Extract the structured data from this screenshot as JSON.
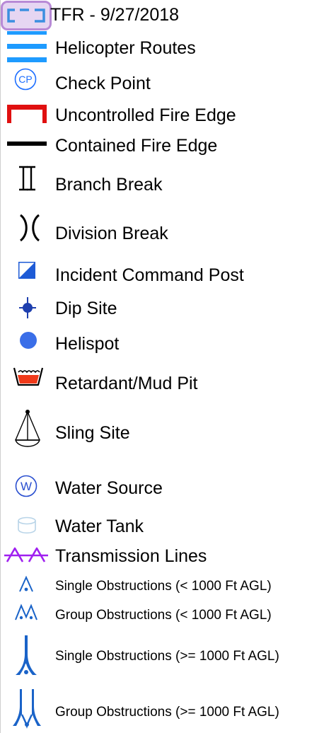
{
  "legend": {
    "items": [
      {
        "key": "tfr",
        "label": "TFR - 9/27/2018",
        "icon": "tfr-boundary-icon"
      },
      {
        "key": "helicopter_routes",
        "label": "Helicopter Routes",
        "icon": "helicopter-route-icon"
      },
      {
        "key": "check_point",
        "label": "Check Point",
        "icon": "check-point-icon",
        "icon_text": "CP"
      },
      {
        "key": "uncontrolled_fire_edge",
        "label": "Uncontrolled Fire Edge",
        "icon": "uncontrolled-fire-edge-icon"
      },
      {
        "key": "contained_fire_edge",
        "label": "Contained Fire Edge",
        "icon": "contained-fire-edge-icon"
      },
      {
        "key": "branch_break",
        "label": "Branch Break",
        "icon": "branch-break-icon"
      },
      {
        "key": "division_break",
        "label": "Division Break",
        "icon": "division-break-icon"
      },
      {
        "key": "incident_command_post",
        "label": "Incident Command Post",
        "icon": "incident-command-post-icon"
      },
      {
        "key": "dip_site",
        "label": "Dip Site",
        "icon": "dip-site-icon"
      },
      {
        "key": "helispot",
        "label": "Helispot",
        "icon": "helispot-icon"
      },
      {
        "key": "retardant_mud_pit",
        "label": "Retardant/Mud Pit",
        "icon": "retardant-mud-pit-icon"
      },
      {
        "key": "sling_site",
        "label": "Sling Site",
        "icon": "sling-site-icon"
      },
      {
        "key": "water_source",
        "label": "Water Source",
        "icon": "water-source-icon",
        "icon_text": "W"
      },
      {
        "key": "water_tank",
        "label": "Water Tank",
        "icon": "water-tank-icon"
      },
      {
        "key": "transmission_lines",
        "label": "Transmission Lines",
        "icon": "transmission-lines-icon"
      },
      {
        "key": "single_obstructions_low",
        "label": "Single Obstructions (< 1000 Ft AGL)",
        "icon": "single-obstruction-low-icon"
      },
      {
        "key": "group_obstructions_low",
        "label": "Group Obstructions (< 1000 Ft AGL)",
        "icon": "group-obstruction-low-icon"
      },
      {
        "key": "single_obstructions_high",
        "label": "Single Obstructions (>= 1000 Ft AGL)",
        "icon": "single-obstruction-high-icon"
      },
      {
        "key": "group_obstructions_high",
        "label": "Group Obstructions (>= 1000 Ft AGL)",
        "icon": "group-obstruction-high-icon"
      }
    ]
  },
  "colors": {
    "tfr_outline": "#b88ad6",
    "tfr_fill": "#e6d6f2",
    "tfr_dash": "#3b8fe0",
    "helicopter_route": "#1e9bff",
    "check_point": "#1e6fff",
    "uncontrolled_fire_edge": "#e01010",
    "contained_fire_edge": "#000000",
    "incident_command_post": "#1e5bd6",
    "dip_site": "#1e3fae",
    "helispot": "#3a6ee8",
    "retardant": "#f03a1a",
    "water_source": "#2a4fd0",
    "water_tank": "#b8d4e8",
    "transmission_lines": "#a020f0",
    "obstruction": "#1a63c8",
    "left_rule": "#cfcfcf"
  }
}
